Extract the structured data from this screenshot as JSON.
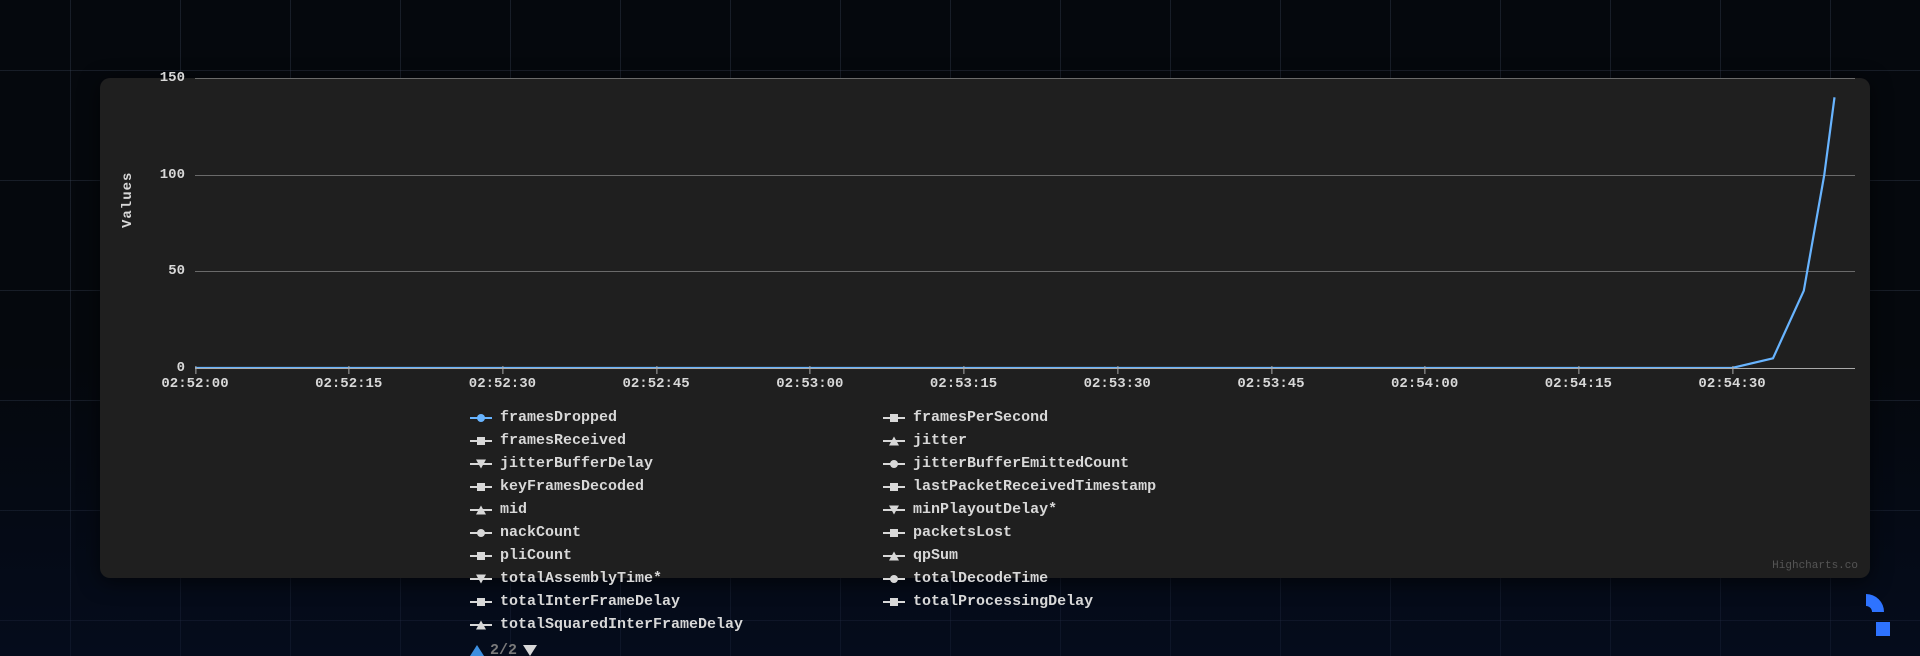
{
  "chart_data": {
    "type": "line",
    "ylabel": "Values",
    "xlabel": "",
    "ylim": [
      0,
      150
    ],
    "y_ticks": [
      0,
      50,
      100,
      150
    ],
    "x_ticks": [
      "02:52:00",
      "02:52:15",
      "02:52:30",
      "02:52:45",
      "02:53:00",
      "02:53:15",
      "02:53:30",
      "02:53:45",
      "02:54:00",
      "02:54:15",
      "02:54:30"
    ],
    "x": [
      "02:52:00",
      "02:52:15",
      "02:52:30",
      "02:52:45",
      "02:53:00",
      "02:53:15",
      "02:53:30",
      "02:53:45",
      "02:54:00",
      "02:54:15",
      "02:54:30",
      "02:54:34",
      "02:54:37",
      "02:54:39",
      "02:54:40"
    ],
    "series": [
      {
        "name": "framesDropped",
        "color": "#68b4ff",
        "marker": "circle",
        "values": [
          0,
          0,
          0,
          0,
          0,
          0,
          0,
          0,
          0,
          0,
          0,
          5,
          40,
          100,
          140
        ]
      },
      {
        "name": "framesPerSecond",
        "color": "#1f1f1f",
        "marker": "diamond",
        "values": null
      },
      {
        "name": "framesReceived",
        "color": "#d8d8d8",
        "marker": "square",
        "values": null
      },
      {
        "name": "jitter",
        "color": "#d8d8d8",
        "marker": "tri-up",
        "values": null
      },
      {
        "name": "jitterBufferDelay",
        "color": "#d8d8d8",
        "marker": "tri-down",
        "values": null
      },
      {
        "name": "jitterBufferEmittedCount",
        "color": "#d8d8d8",
        "marker": "circle",
        "values": null
      },
      {
        "name": "keyFramesDecoded",
        "color": "#d8d8d8",
        "marker": "diamond",
        "values": null
      },
      {
        "name": "lastPacketReceivedTimestamp",
        "color": "#d8d8d8",
        "marker": "square",
        "values": null
      },
      {
        "name": "mid",
        "color": "#d8d8d8",
        "marker": "tri-up",
        "values": null
      },
      {
        "name": "minPlayoutDelay*",
        "color": "#d8d8d8",
        "marker": "tri-down",
        "values": null
      },
      {
        "name": "nackCount",
        "color": "#d8d8d8",
        "marker": "circle",
        "values": null
      },
      {
        "name": "packetsLost",
        "color": "#d8d8d8",
        "marker": "diamond",
        "values": null
      },
      {
        "name": "pliCount",
        "color": "#d8d8d8",
        "marker": "square",
        "values": null
      },
      {
        "name": "qpSum",
        "color": "#d8d8d8",
        "marker": "tri-up",
        "values": null
      },
      {
        "name": "totalAssemblyTime*",
        "color": "#d8d8d8",
        "marker": "tri-down",
        "values": null
      },
      {
        "name": "totalDecodeTime",
        "color": "#d8d8d8",
        "marker": "circle",
        "values": null
      },
      {
        "name": "totalInterFrameDelay",
        "color": "#d8d8d8",
        "marker": "diamond",
        "values": null
      },
      {
        "name": "totalProcessingDelay",
        "color": "#d8d8d8",
        "marker": "square",
        "values": null
      },
      {
        "name": "totalSquaredInterFrameDelay",
        "color": "#d8d8d8",
        "marker": "tri-up",
        "values": null
      }
    ],
    "legend_layout": [
      [
        "framesDropped",
        "framesPerSecond"
      ],
      [
        "framesReceived",
        "jitter"
      ],
      [
        "jitterBufferDelay",
        "jitterBufferEmittedCount"
      ],
      [
        "keyFramesDecoded",
        "lastPacketReceivedTimestamp"
      ],
      [
        "mid",
        "minPlayoutDelay*"
      ],
      [
        "nackCount",
        "packetsLost"
      ],
      [
        "pliCount",
        "qpSum"
      ],
      [
        "totalAssemblyTime*",
        "totalDecodeTime"
      ],
      [
        "totalInterFrameDelay",
        "totalProcessingDelay"
      ],
      [
        "totalSquaredInterFrameDelay"
      ]
    ],
    "pager": "2/2",
    "credit": "Highcharts.co"
  },
  "colors": {
    "active_series": "#68b4ff",
    "pager_active": "#3d8fe0",
    "pager_idle": "#d8d8d8",
    "brand": "#2e73ff"
  }
}
